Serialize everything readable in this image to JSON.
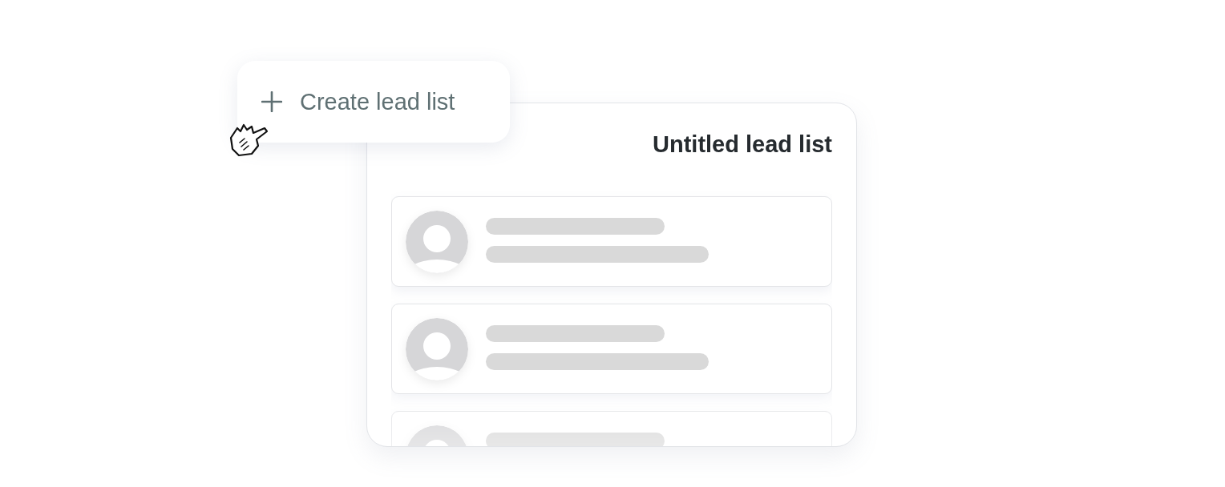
{
  "create_button": {
    "label": "Create lead list"
  },
  "lead_list": {
    "title": "Untitled lead list"
  }
}
